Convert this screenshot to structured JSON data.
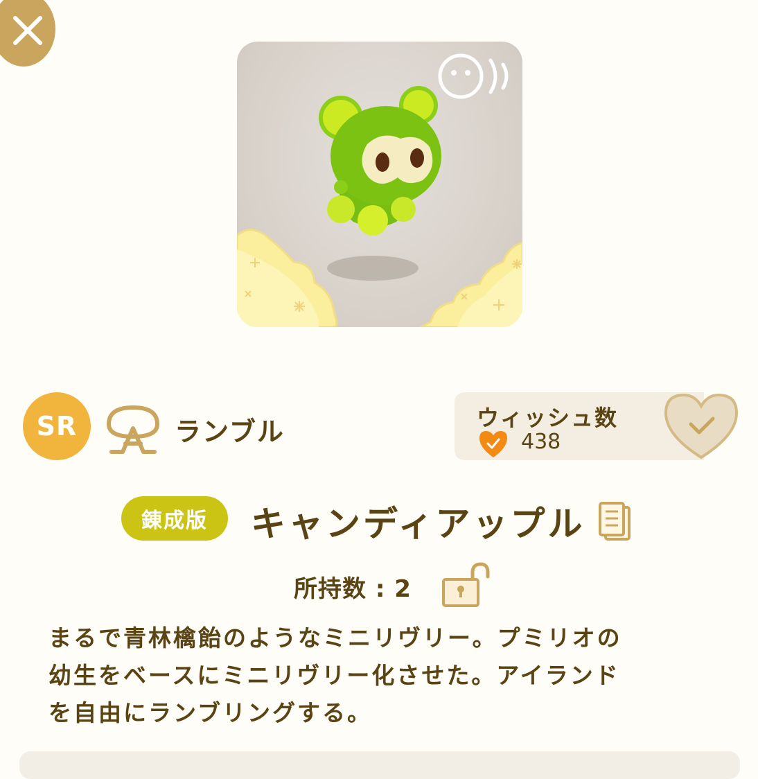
{
  "header": {
    "close_icon": "close-icon"
  },
  "preview": {
    "sound_icon": "sound-face-icon",
    "colors": {
      "creature": "#7cc213",
      "accent": "#d3ec22",
      "cloud": "#fbef9e"
    }
  },
  "info": {
    "rarity": "SR",
    "rarity_color": "#f1b43c",
    "type_icon": "ramble-icon",
    "type_label": "ランブル"
  },
  "wishlist": {
    "label": "ウィッシュ数",
    "count": "438",
    "heart_color": "#f28a13"
  },
  "item": {
    "edition_badge": "錬成版",
    "edition_color": "#ccc414",
    "name": "キャンディアップル",
    "owned": "所持数 : 2"
  },
  "description": {
    "line1": "まるで青林檎飴のようなミニリヴリー。プミリオの",
    "line2": "幼生をベースにミニリヴリー化させた。アイランド",
    "line3": "を自由にランブリングする。"
  }
}
